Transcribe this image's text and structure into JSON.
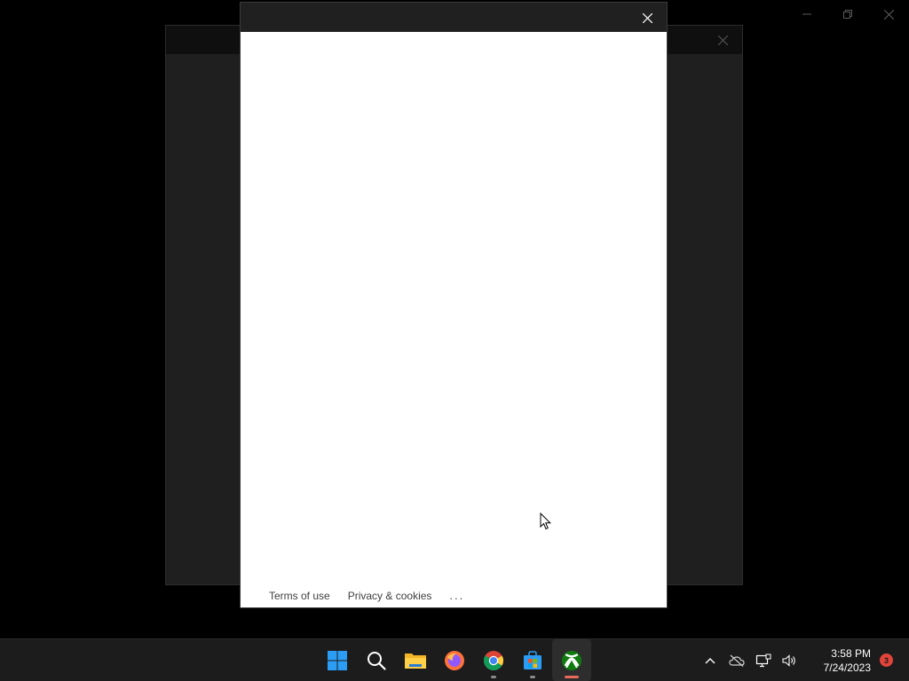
{
  "dialog": {
    "footer": {
      "terms_label": "Terms of use",
      "privacy_label": "Privacy & cookies",
      "more_label": "..."
    }
  },
  "taskbar": {
    "apps": [
      {
        "name": "start-icon"
      },
      {
        "name": "search-icon"
      },
      {
        "name": "file-explorer-icon"
      },
      {
        "name": "firefox-icon"
      },
      {
        "name": "chrome-icon"
      },
      {
        "name": "microsoft-store-icon"
      },
      {
        "name": "xbox-icon"
      }
    ],
    "clock": {
      "time": "3:58 PM",
      "date": "7/24/2023"
    },
    "notifications_count": "3"
  },
  "colors": {
    "accent_xbox": "#107c10",
    "badge": "#e0443a",
    "taskbar": "#1c1c1c"
  }
}
